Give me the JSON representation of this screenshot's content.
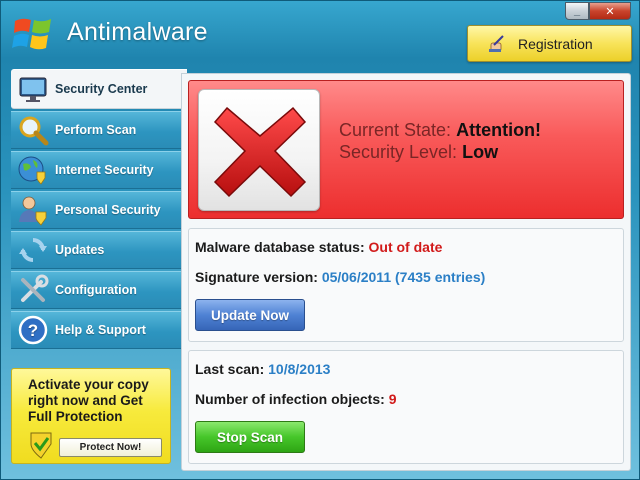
{
  "window": {
    "title": "Antimalware",
    "controls": {
      "minimize": "_",
      "close": "✕"
    }
  },
  "header": {
    "registration_label": "Registration",
    "registration_icon": "hand-pen-icon"
  },
  "sidebar": {
    "items": [
      {
        "label": "Security Center",
        "icon": "monitor-icon",
        "active": true
      },
      {
        "label": "Perform Scan",
        "icon": "magnifier-icon",
        "active": false
      },
      {
        "label": "Internet Security",
        "icon": "globe-shield-icon",
        "active": false
      },
      {
        "label": "Personal Security",
        "icon": "user-shield-icon",
        "active": false
      },
      {
        "label": "Updates",
        "icon": "refresh-icon",
        "active": false
      },
      {
        "label": "Configuration",
        "icon": "tools-icon",
        "active": false
      },
      {
        "label": "Help & Support",
        "icon": "question-icon",
        "active": false
      }
    ]
  },
  "promo": {
    "line1": "Activate your copy",
    "line2": "right now and",
    "line2_bold": "Get",
    "line3": "Full Protection",
    "button_label": "Protect Now!"
  },
  "alert": {
    "state_label": "Current State:",
    "state_value": "Attention!",
    "level_label": "Security Level:",
    "level_value": "Low"
  },
  "database": {
    "status_label": "Malware database status:",
    "status_value": "Out of date",
    "signature_label": "Signature version:",
    "signature_value": "05/06/2011 (7435 entries)",
    "update_button": "Update Now"
  },
  "scan": {
    "last_label": "Last scan:",
    "last_value": "10/8/2013",
    "infections_label": "Number of infection objects:",
    "infections_value": "9",
    "stop_button": "Stop Scan"
  },
  "colors": {
    "accent_blue": "#2a93bd",
    "alert_red": "#ec2e2e",
    "promo_yellow": "#f7ea3c",
    "value_red": "#d11a1a",
    "value_blue": "#2b7fc6"
  }
}
